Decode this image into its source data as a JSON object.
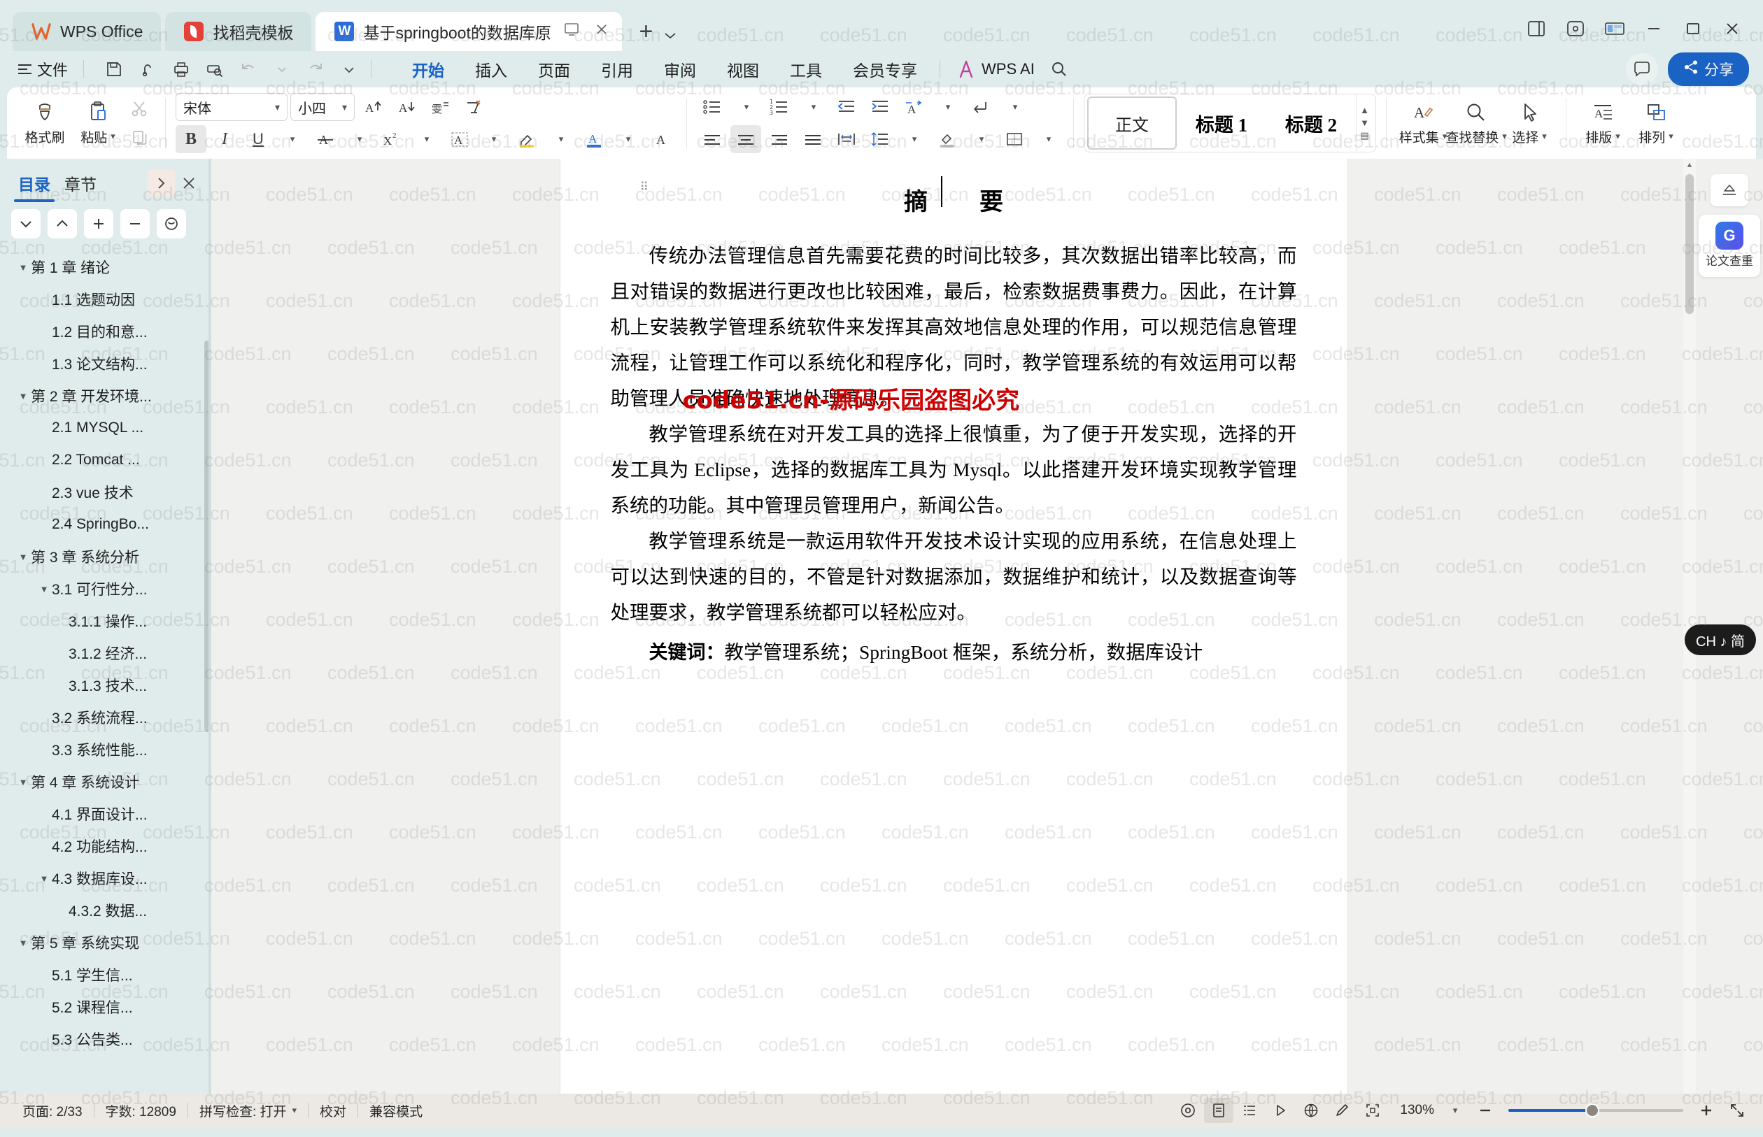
{
  "window": {
    "tabs": [
      {
        "label": "WPS Office",
        "icon": "wps-logo"
      },
      {
        "label": "找稻壳模板",
        "icon": "daoke-logo"
      },
      {
        "label": "基于springboot的数据库原理",
        "icon": "word-doc-icon",
        "active": true
      }
    ],
    "new_tab_label": "+",
    "controls": {
      "minimize": "minimize-icon",
      "maximize": "maximize-icon",
      "close": "close-icon"
    }
  },
  "menu": {
    "file_label": "文件",
    "quick_access": [
      "save-icon",
      "search-doc-icon",
      "print-icon",
      "print-preview-icon",
      "undo-icon",
      "redo-icon",
      "customize-chevron-icon"
    ],
    "ribbon_tabs": [
      {
        "label": "开始",
        "active": true
      },
      {
        "label": "插入",
        "active": false
      },
      {
        "label": "页面",
        "active": false
      },
      {
        "label": "引用",
        "active": false
      },
      {
        "label": "审阅",
        "active": false
      },
      {
        "label": "视图",
        "active": false
      },
      {
        "label": "工具",
        "active": false
      },
      {
        "label": "会员专享",
        "active": false
      }
    ],
    "ai_label": "WPS AI",
    "share_label": "分享"
  },
  "toolbar": {
    "format_painter": "格式刷",
    "paste": "粘贴",
    "cut_icon": "scissors-icon",
    "copy_icon": "copy-icon",
    "font_name": "宋体",
    "font_size": "小四",
    "grow_font": "increase-font-icon",
    "shrink_font": "decrease-font-icon",
    "phonetic": "pinyin-guide-icon",
    "clear_format": "clear-format-icon",
    "bold": "B",
    "italic": "I",
    "underline": "U",
    "strikethrough": "A-strike-icon",
    "superscript": "X²",
    "char_border": "A-border-icon",
    "highlight": "highlight-icon",
    "font_color": "font-color-icon",
    "char_shading": "char-shading-icon",
    "bullets": "bullet-list-icon",
    "numbering": "numbered-list-icon",
    "decrease_indent": "decrease-indent-icon",
    "increase_indent": "increase-indent-icon",
    "sort_asian": "asian-layout-icon",
    "show_marks": "show-formatting-marks-icon",
    "align_left": "align-left-icon",
    "align_center": "align-center-icon",
    "align_right": "align-right-icon",
    "align_justify": "align-justify-icon",
    "distribute": "distribute-icon",
    "line_spacing": "line-spacing-icon",
    "shading": "paragraph-shading-icon",
    "borders": "borders-icon",
    "styles": [
      {
        "label": "正文",
        "selected": true
      },
      {
        "label": "标题 1",
        "selected": false
      },
      {
        "label": "标题 2",
        "selected": false
      }
    ],
    "style_set": "样式集",
    "find_replace": "查找替换",
    "select": "选择",
    "typeset": "排版",
    "arrange": "排列"
  },
  "sidebar": {
    "tabs": [
      {
        "label": "目录",
        "active": true
      },
      {
        "label": "章节",
        "active": false
      }
    ],
    "expand_icon": "chevron-right-icon",
    "close_icon": "close-icon",
    "tools": [
      "chevron-down-icon",
      "chevron-up-icon",
      "plus-icon",
      "minus-icon",
      "collapse-all-icon"
    ],
    "toc": [
      {
        "label": "第 1 章 绪论",
        "level": 0,
        "expandable": true,
        "expanded": true
      },
      {
        "label": "1.1 选题动因",
        "level": 1,
        "expandable": false
      },
      {
        "label": "1.2 目的和意...",
        "level": 1,
        "expandable": false
      },
      {
        "label": "1.3 论文结构...",
        "level": 1,
        "expandable": false
      },
      {
        "label": "第 2 章 开发环境...",
        "level": 0,
        "expandable": true,
        "expanded": true
      },
      {
        "label": "2.1 MYSQL ...",
        "level": 1,
        "expandable": false
      },
      {
        "label": "2.2 Tomcat ...",
        "level": 1,
        "expandable": false
      },
      {
        "label": "2.3 vue 技术",
        "level": 1,
        "expandable": false
      },
      {
        "label": "2.4 SpringBo...",
        "level": 1,
        "expandable": false
      },
      {
        "label": "第 3 章 系统分析",
        "level": 0,
        "expandable": true,
        "expanded": true
      },
      {
        "label": "3.1 可行性分...",
        "level": 1,
        "expandable": true,
        "expanded": true
      },
      {
        "label": "3.1.1 操作...",
        "level": 2,
        "expandable": false
      },
      {
        "label": "3.1.2 经济...",
        "level": 2,
        "expandable": false
      },
      {
        "label": "3.1.3 技术...",
        "level": 2,
        "expandable": false
      },
      {
        "label": "3.2 系统流程...",
        "level": 1,
        "expandable": false
      },
      {
        "label": "3.3 系统性能...",
        "level": 1,
        "expandable": false
      },
      {
        "label": "第 4 章 系统设计",
        "level": 0,
        "expandable": true,
        "expanded": true
      },
      {
        "label": "4.1 界面设计...",
        "level": 1,
        "expandable": false
      },
      {
        "label": "4.2 功能结构...",
        "level": 1,
        "expandable": false
      },
      {
        "label": "4.3 数据库设...",
        "level": 1,
        "expandable": true,
        "expanded": true
      },
      {
        "label": "4.3.2 数据...",
        "level": 2,
        "expandable": false
      },
      {
        "label": "第 5 章 系统实现",
        "level": 0,
        "expandable": true,
        "expanded": true
      },
      {
        "label": "5.1 学生信...",
        "level": 1,
        "expandable": false
      },
      {
        "label": "5.2 课程信...",
        "level": 1,
        "expandable": false
      },
      {
        "label": "5.3 公告类...",
        "level": 1,
        "expandable": false
      }
    ]
  },
  "document": {
    "title": "摘　要",
    "paragraphs": [
      "传统办法管理信息首先需要花费的时间比较多，其次数据出错率比较高，而且对错误的数据进行更改也比较困难，最后，检索数据费事费力。因此，在计算机上安装教学管理系统软件来发挥其高效地信息处理的作用，可以规范信息管理流程，让管理工作可以系统化和程序化，同时，教学管理系统的有效运用可以帮助管理人员准确快速地处理信息。",
      "教学管理系统在对开发工具的选择上很慎重，为了便于开发实现，选择的开发工具为 Eclipse，选择的数据库工具为 Mysql。以此搭建开发环境实现教学管理系统的功能。其中管理员管理用户，新闻公告。",
      "教学管理系统是一款运用软件开发技术设计实现的应用系统，在信息处理上可以达到快速的目的，不管是针对数据添加，数据维护和统计，以及数据查询等处理要求，教学管理系统都可以轻松应对。"
    ],
    "keywords_label": "关键词：",
    "keywords_text": "教学管理系统；SpringBoot 框架，系统分析，数据库设计",
    "overlay_watermark": "code51.cn-源码乐园盗图必究",
    "page_watermark_text": "code51.cn"
  },
  "right_rail": {
    "collapse_icon": "panel-collapse-icon",
    "check_badge": "G",
    "check_label": "论文查重",
    "ime_indicator": "CH ♪ 简"
  },
  "status": {
    "page_label": "页面: 2/33",
    "word_count": "字数: 12809",
    "spellcheck": "拼写检查: 打开",
    "proofread": "校对",
    "compat_mode": "兼容模式",
    "view_icons": [
      "read-mode-icon",
      "page-view-icon",
      "outline-view-icon",
      "web-view-icon",
      "global-icon",
      "pen-icon",
      "focus-icon"
    ],
    "zoom_level": "130%",
    "zoom_out": "minus-icon",
    "zoom_in": "plus-icon",
    "fullscreen": "fullscreen-icon"
  },
  "colors": {
    "accent": "#1a62c4",
    "app_bg": "#dfeceb",
    "toolbar_bg": "#ffffff",
    "status_bg": "#ece9e4",
    "doc_bg": "#f0f0ef",
    "watermark_red": "#cc0000"
  }
}
